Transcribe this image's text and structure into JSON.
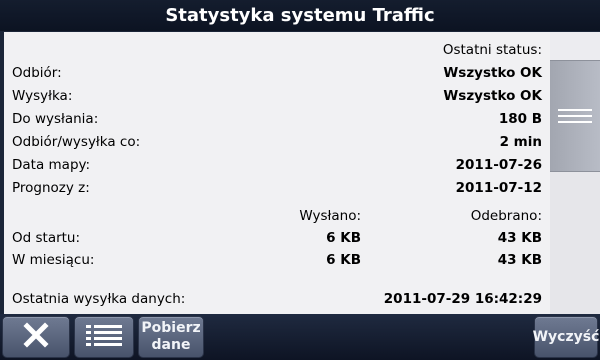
{
  "title": "Statystyka systemu Traffic",
  "status_header": "Ostatni status:",
  "rows": [
    {
      "label": "Odbiór:",
      "value": "Wszystko OK"
    },
    {
      "label": "Wysyłka:",
      "value": "Wszystko OK"
    },
    {
      "label": "Do wysłania:",
      "value": "180 B"
    },
    {
      "label": "Odbiór/wysyłka co:",
      "value": "2 min"
    },
    {
      "label": "Data mapy:",
      "value": "2011-07-26"
    },
    {
      "label": "Prognozy z:",
      "value": "2011-07-12"
    }
  ],
  "transfer": {
    "sent_header": "Wysłano:",
    "received_header": "Odebrano:",
    "rows": [
      {
        "label": "Od startu:",
        "sent": "6 KB",
        "received": "43 KB"
      },
      {
        "label": "W miesiącu:",
        "sent": "6 KB",
        "received": "43 KB"
      }
    ]
  },
  "last_upload": {
    "label": "Ostatnia wysyłka danych:",
    "value": "2011-07-29 16:42:29"
  },
  "toolbar": {
    "close_icon": "close-icon",
    "list_icon": "list-icon",
    "fetch_line1": "Pobierz",
    "fetch_line2": "dane",
    "clear_label": "Wyczyść"
  }
}
